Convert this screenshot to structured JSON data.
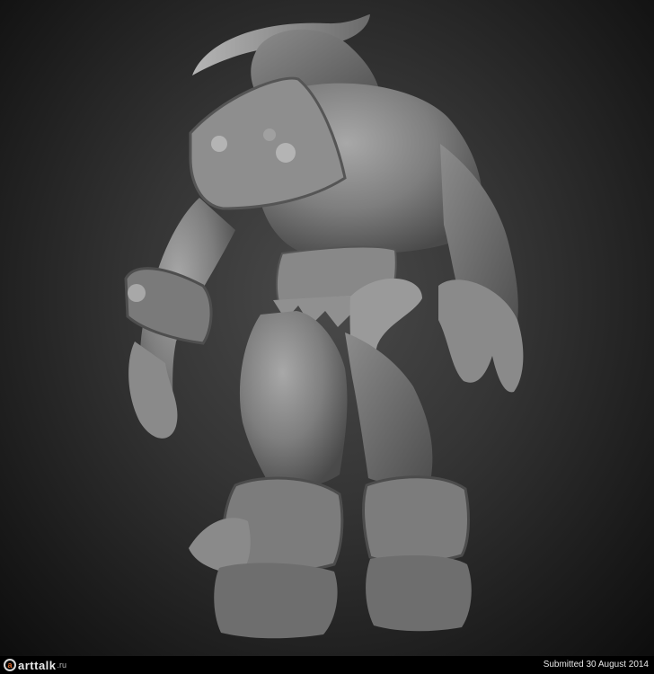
{
  "footer": {
    "logo_main": "arttalk",
    "logo_domain": ".ru",
    "submitted_text": "Submitted 30 August 2014"
  },
  "colors": {
    "background": "#3a3a3a",
    "sculpt_clay": "#8a8a8a",
    "footer_bg": "#000000",
    "logo_accent": "#e06a2a"
  }
}
